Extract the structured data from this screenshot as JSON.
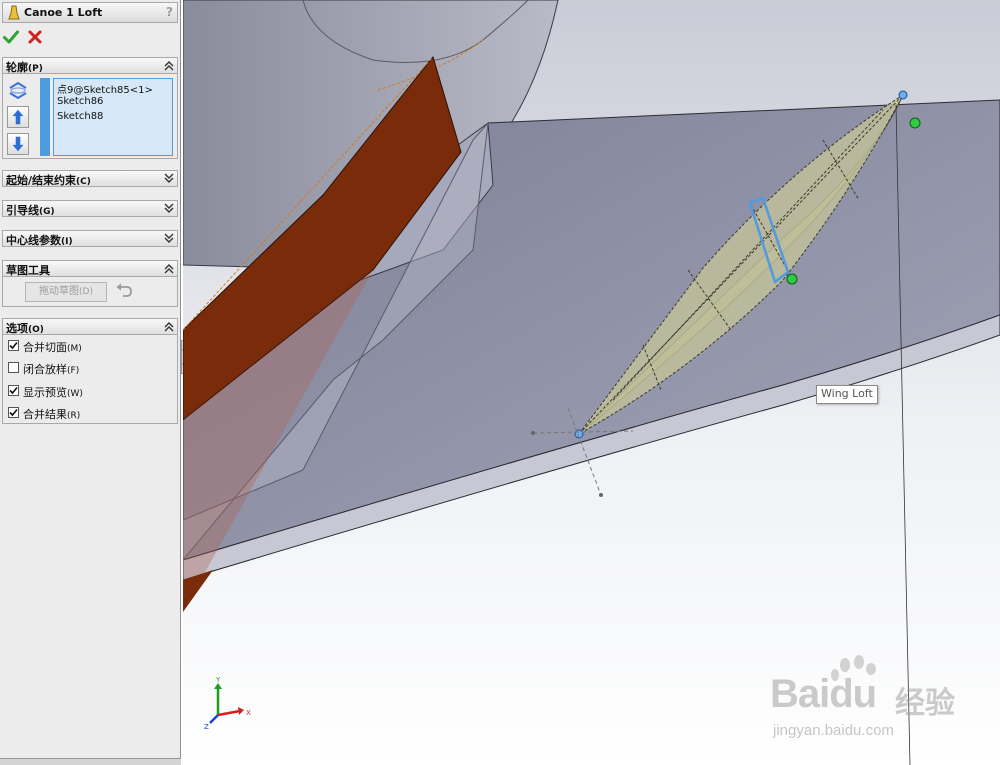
{
  "panel": {
    "title": "Canoe 1 Loft",
    "help": "?",
    "profiles": {
      "header": "轮廓",
      "shortcut": "(P)",
      "items": [
        "点9@Sketch85<1>",
        "Sketch86",
        "Sketch88"
      ]
    },
    "start_end": {
      "header": "起始/结束约束",
      "shortcut": "(C)"
    },
    "guides": {
      "header": "引导线",
      "shortcut": "(G)"
    },
    "centerline": {
      "header": "中心线参数",
      "shortcut": "(I)"
    },
    "sketch_tools": {
      "header": "草图工具",
      "drag_label": "拖动草图",
      "drag_shortcut": "(D)"
    },
    "options": {
      "header": "选项",
      "shortcut": "(O)",
      "items": [
        {
          "label": "合并切面",
          "shortcut": "(M)",
          "checked": true
        },
        {
          "label": "闭合放样",
          "shortcut": "(F)",
          "checked": false
        },
        {
          "label": "显示预览",
          "shortcut": "(W)",
          "checked": true
        },
        {
          "label": "合并结果",
          "shortcut": "(R)",
          "checked": true
        }
      ]
    }
  },
  "viewport": {
    "tooltip": "Wing Loft",
    "triad": {
      "x": "X",
      "y": "Y",
      "z": "Z"
    }
  },
  "watermark": {
    "brand": "Baidu",
    "cn": "经验",
    "url": "jingyan.baidu.com"
  },
  "colors": {
    "accent_blue": "#4f9be0",
    "ok_green": "#2fa12f",
    "cancel_red": "#d22020",
    "body_grey": "#8e8fa6",
    "panel_orange": "#7a2c0a",
    "loft_olive": "#b5b48c"
  }
}
